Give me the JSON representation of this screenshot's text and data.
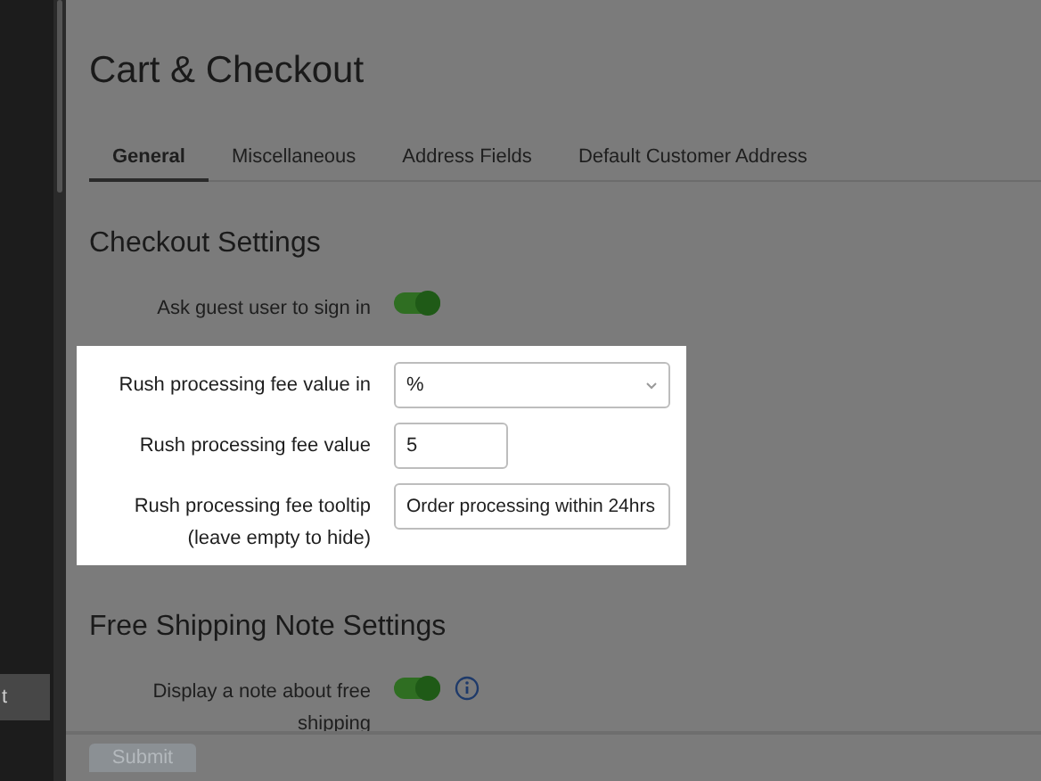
{
  "sidebar": {
    "items": [
      {
        "label": "t",
        "selected": true
      }
    ]
  },
  "page": {
    "title": "Cart & Checkout"
  },
  "tabs": [
    {
      "label": "General",
      "selected": true
    },
    {
      "label": "Miscellaneous",
      "selected": false
    },
    {
      "label": "Address Fields",
      "selected": false
    },
    {
      "label": "Default Customer Address",
      "selected": false
    }
  ],
  "sections": [
    {
      "heading": "Checkout Settings",
      "fields": [
        {
          "kind": "toggle",
          "label": "Ask guest user to sign in",
          "on": true,
          "highlighted": false,
          "info": false
        },
        {
          "kind": "select",
          "label": "Rush processing fee value in",
          "value": "%",
          "highlighted": true
        },
        {
          "kind": "number",
          "label": "Rush processing fee value",
          "value": "5",
          "highlighted": true
        },
        {
          "kind": "text",
          "label": "Rush processing fee tooltip (leave empty to hide)",
          "value": "Order processing within 24hrs",
          "highlighted": true
        }
      ]
    },
    {
      "heading": "Free Shipping Note Settings",
      "fields": [
        {
          "kind": "toggle",
          "label": "Display a note about free shipping",
          "on": true,
          "highlighted": false,
          "info": true
        }
      ]
    }
  ],
  "footer": {
    "submit": {
      "label": "Submit",
      "disabled": true
    }
  }
}
